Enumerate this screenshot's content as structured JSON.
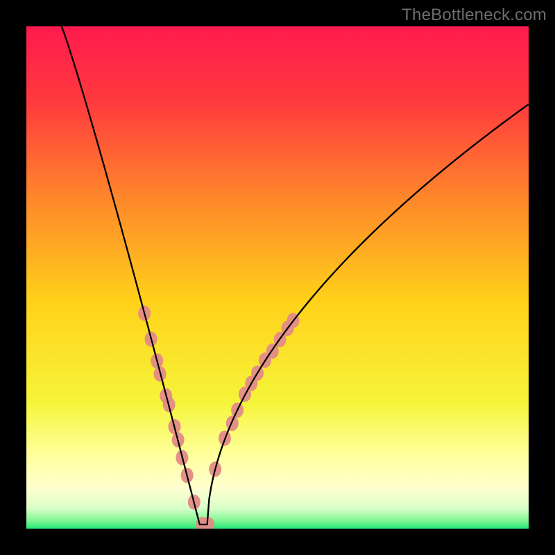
{
  "watermark": "TheBottleneck.com",
  "chart_data": {
    "type": "line",
    "title": "",
    "xlabel": "",
    "ylabel": "",
    "xlim": [
      0,
      1
    ],
    "ylim": [
      0,
      1
    ],
    "series": [
      {
        "name": "bottleneck-curve",
        "x": [
          0.0,
          0.05,
          0.1,
          0.15,
          0.2,
          0.25,
          0.28,
          0.3,
          0.32,
          0.34,
          0.36,
          0.38,
          0.4,
          0.45,
          0.5,
          0.55,
          0.6,
          0.65,
          0.7,
          0.75,
          0.8,
          0.85,
          0.9,
          0.95,
          1.0
        ],
        "y": [
          1.0,
          0.87,
          0.74,
          0.6,
          0.45,
          0.27,
          0.14,
          0.06,
          0.01,
          0.0,
          0.0,
          0.02,
          0.05,
          0.14,
          0.24,
          0.33,
          0.41,
          0.49,
          0.56,
          0.62,
          0.68,
          0.73,
          0.78,
          0.82,
          0.86
        ]
      }
    ],
    "highlight_dots": {
      "name": "highlight-points",
      "color": "#e28b87",
      "points": [
        {
          "x": 0.235,
          "y": 0.32
        },
        {
          "x": 0.248,
          "y": 0.273
        },
        {
          "x": 0.26,
          "y": 0.228
        },
        {
          "x": 0.266,
          "y": 0.203
        },
        {
          "x": 0.278,
          "y": 0.158
        },
        {
          "x": 0.284,
          "y": 0.13
        },
        {
          "x": 0.295,
          "y": 0.09
        },
        {
          "x": 0.302,
          "y": 0.063
        },
        {
          "x": 0.31,
          "y": 0.035
        },
        {
          "x": 0.32,
          "y": 0.014
        },
        {
          "x": 0.334,
          "y": 0.006
        },
        {
          "x": 0.35,
          "y": 0.005
        },
        {
          "x": 0.362,
          "y": 0.005
        },
        {
          "x": 0.376,
          "y": 0.018
        },
        {
          "x": 0.395,
          "y": 0.048
        },
        {
          "x": 0.41,
          "y": 0.078
        },
        {
          "x": 0.42,
          "y": 0.1
        },
        {
          "x": 0.435,
          "y": 0.13
        },
        {
          "x": 0.448,
          "y": 0.155
        },
        {
          "x": 0.46,
          "y": 0.178
        },
        {
          "x": 0.475,
          "y": 0.205
        },
        {
          "x": 0.49,
          "y": 0.232
        },
        {
          "x": 0.505,
          "y": 0.26
        },
        {
          "x": 0.52,
          "y": 0.285
        },
        {
          "x": 0.531,
          "y": 0.305
        }
      ]
    },
    "background": {
      "type": "vertical-gradient",
      "stops": [
        {
          "offset": 0.0,
          "color": "#ff1a4e"
        },
        {
          "offset": 0.15,
          "color": "#ff3a3e"
        },
        {
          "offset": 0.35,
          "color": "#ff8a2a"
        },
        {
          "offset": 0.55,
          "color": "#ffd21a"
        },
        {
          "offset": 0.75,
          "color": "#f5f53a"
        },
        {
          "offset": 0.85,
          "color": "#ffff9a"
        },
        {
          "offset": 0.92,
          "color": "#ffffd0"
        },
        {
          "offset": 0.96,
          "color": "#d8ffc8"
        },
        {
          "offset": 0.985,
          "color": "#7cf590"
        },
        {
          "offset": 1.0,
          "color": "#22e87a"
        }
      ]
    }
  }
}
